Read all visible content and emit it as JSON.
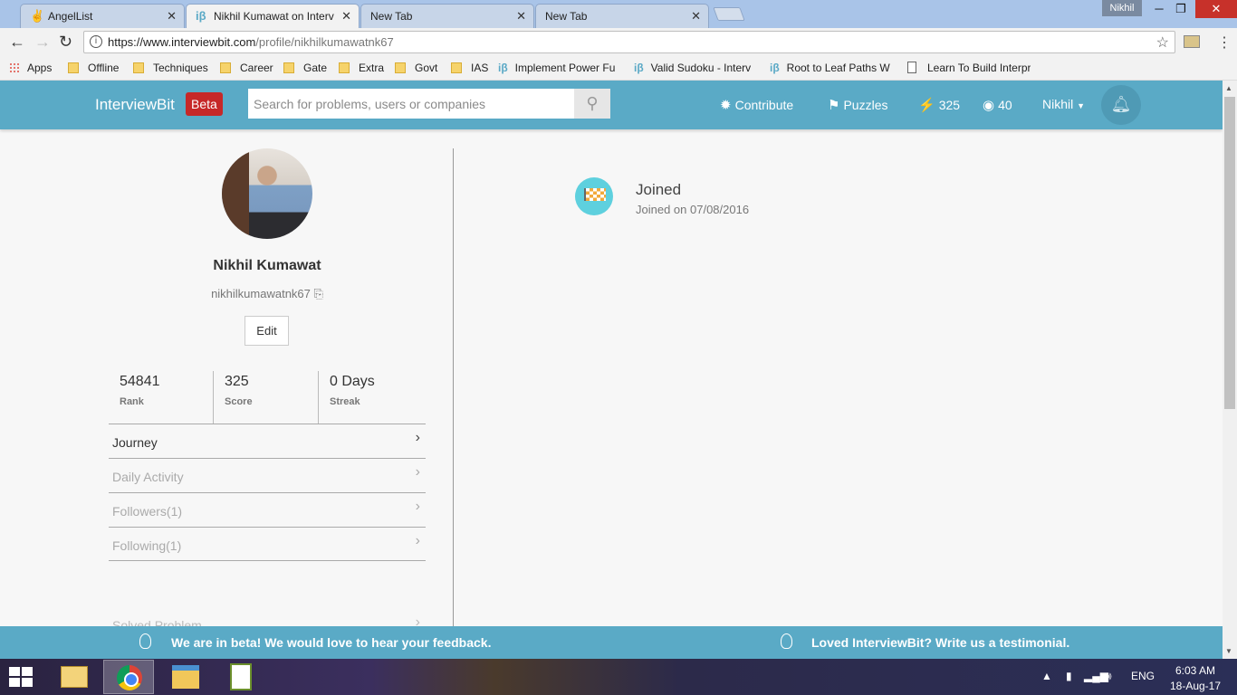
{
  "browser": {
    "tabs": [
      {
        "title": "AngelList",
        "icon": "angellist-icon",
        "active": false
      },
      {
        "title": "Nikhil Kumawat on Interv",
        "icon": "interviewbit-icon",
        "active": true
      },
      {
        "title": "New Tab",
        "icon": "",
        "active": false
      },
      {
        "title": "New Tab",
        "icon": "",
        "active": false
      }
    ],
    "profile_chip": "Nikhil",
    "url_host": "https://www.interviewbit.com",
    "url_path": "/profile/nikhilkumawatnk67",
    "bookmarks": [
      {
        "label": "Apps",
        "icon": "apps-icon"
      },
      {
        "label": "Offline",
        "icon": "folder-icon"
      },
      {
        "label": "Techniques",
        "icon": "folder-icon"
      },
      {
        "label": "Career",
        "icon": "folder-icon"
      },
      {
        "label": "Gate",
        "icon": "folder-icon"
      },
      {
        "label": "Extra",
        "icon": "folder-icon"
      },
      {
        "label": "Govt",
        "icon": "folder-icon"
      },
      {
        "label": "IAS",
        "icon": "folder-icon"
      },
      {
        "label": "Implement Power Fu",
        "icon": "interviewbit-icon"
      },
      {
        "label": "Valid Sudoku - Interv",
        "icon": "interviewbit-icon"
      },
      {
        "label": "Root to Leaf Paths W",
        "icon": "interviewbit-icon"
      },
      {
        "label": "Learn To Build Interpr",
        "icon": "document-icon"
      }
    ]
  },
  "site": {
    "logo": "InterviewBit",
    "badge": "Beta",
    "search_placeholder": "Search for problems, users or companies",
    "nav": {
      "contribute": "Contribute",
      "puzzles": "Puzzles",
      "score": "325",
      "coins": "40",
      "user": "Nikhil"
    }
  },
  "profile": {
    "name": "Nikhil Kumawat",
    "handle": "nikhilkumawatnk67",
    "handle_icon": "⎘",
    "edit_label": "Edit",
    "stats": [
      {
        "value": "54841",
        "label": "Rank"
      },
      {
        "value": "325",
        "label": "Score"
      },
      {
        "value": "0 Days",
        "label": "Streak"
      }
    ],
    "menu": [
      {
        "label": "Journey",
        "active": true
      },
      {
        "label": "Daily Activity",
        "active": false
      },
      {
        "label": "Followers(1)",
        "active": false
      },
      {
        "label": "Following(1)",
        "active": false
      }
    ],
    "solved_label": "Solved Problem"
  },
  "timeline": {
    "title": "Joined",
    "subtitle": "Joined on 07/08/2016"
  },
  "feedback": {
    "left": "We are in beta! We would love to hear your feedback.",
    "right": "Loved InterviewBit? Write us a testimonial."
  },
  "taskbar": {
    "lang": "ENG",
    "time": "6:03 AM",
    "date": "18-Aug-17"
  },
  "colors": {
    "header": "#5aaac6",
    "beta": "#c62828",
    "timeline_icon": "#5ed0de"
  }
}
